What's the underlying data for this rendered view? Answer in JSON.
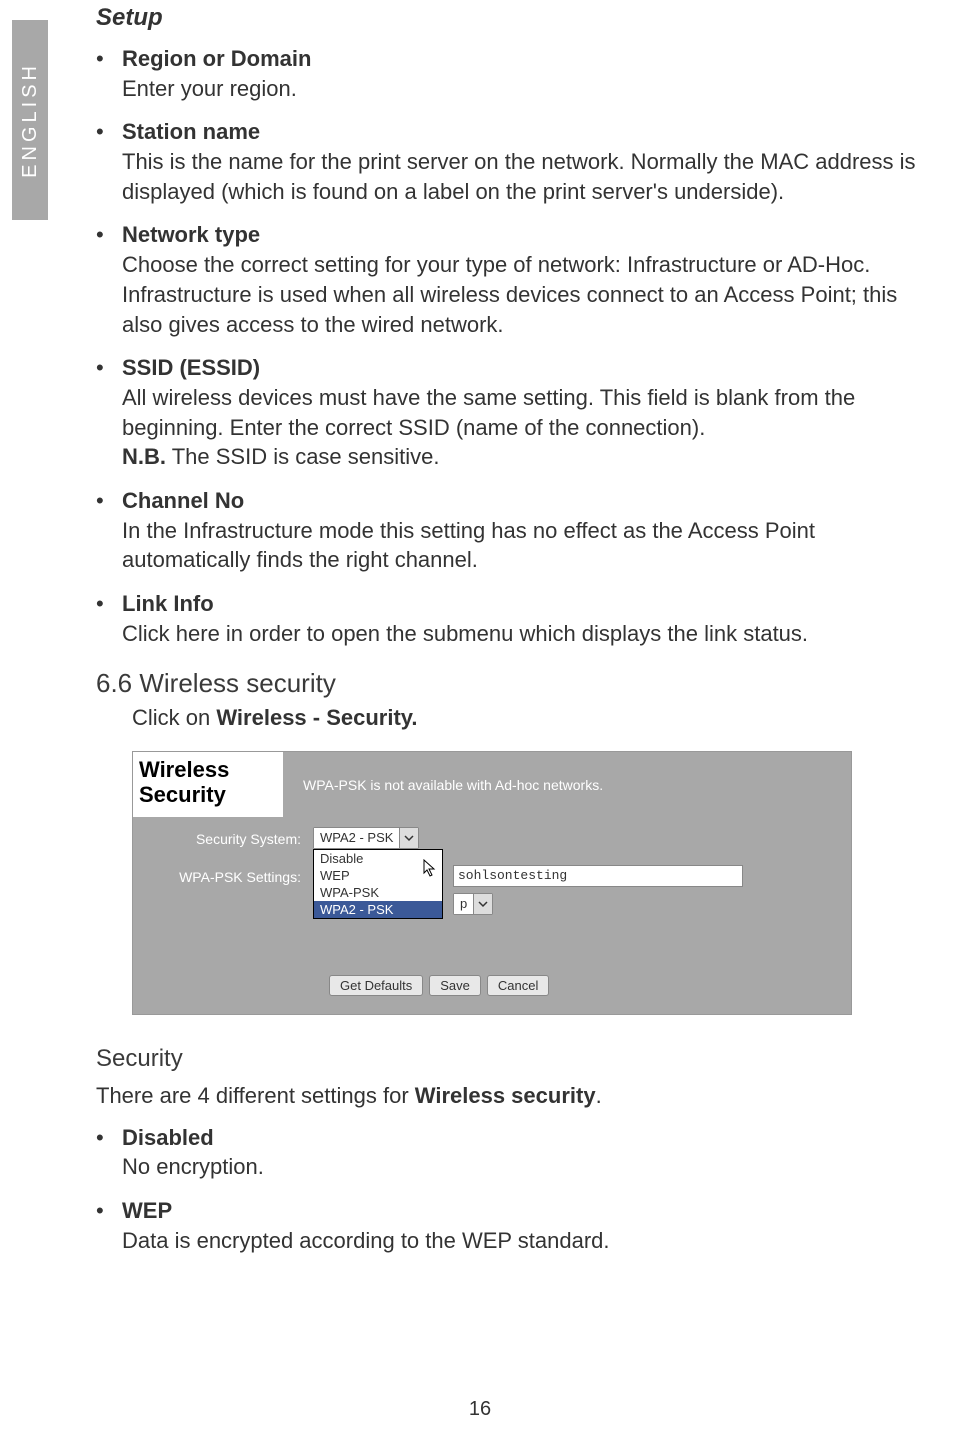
{
  "language_tab": "ENGLISH",
  "setup": {
    "title": "Setup",
    "items": [
      {
        "title": "Region or Domain",
        "desc": "Enter your region."
      },
      {
        "title": "Station name",
        "desc": "This is the name for the print server on the network. Normally the MAC address is displayed (which is found on a label on the print server's underside)."
      },
      {
        "title": "Network type",
        "desc": "Choose the correct setting for your type of network: Infrastructure or AD-Hoc. Infrastructure is used when all wireless devices connect to an Access Point; this also gives access to the wired network."
      },
      {
        "title": "SSID (ESSID)",
        "desc_pre": "All wireless devices must have the same setting. This field is blank from the beginning. Enter the correct SSID (name of the connection).",
        "nb_label": "N.B.",
        "nb_text": " The SSID is case sensitive."
      },
      {
        "title": "Channel No",
        "desc": "In the Infrastructure mode this setting has no effect as the Access Point automatically finds the right channel."
      },
      {
        "title": "Link Info",
        "desc": "Click here in order to open the submenu which displays the link status."
      }
    ]
  },
  "section66": {
    "heading": "6.6 Wireless security",
    "intro_pre": "Click on ",
    "intro_bold": "Wireless - Security."
  },
  "screenshot": {
    "title_l1": "Wireless",
    "title_l2": "Security",
    "note": "WPA-PSK is not available with Ad-hoc networks.",
    "label_security": "Security System:",
    "label_wpa": "WPA-PSK Settings:",
    "select_value": "WPA2 - PSK",
    "dropdown": [
      "Disable",
      "WEP",
      "WPA-PSK",
      "WPA2 - PSK"
    ],
    "text_value": "sohlsontesting",
    "small_select": "p",
    "buttons": [
      "Get Defaults",
      "Save",
      "Cancel"
    ]
  },
  "security": {
    "heading": "Security",
    "line_pre": "There are 4 different settings for ",
    "line_bold": "Wireless security",
    "line_post": ".",
    "items": [
      {
        "title": "Disabled",
        "desc": "No encryption."
      },
      {
        "title": "WEP",
        "desc": "Data is encrypted according to the WEP standard."
      }
    ]
  },
  "page_number": "16"
}
